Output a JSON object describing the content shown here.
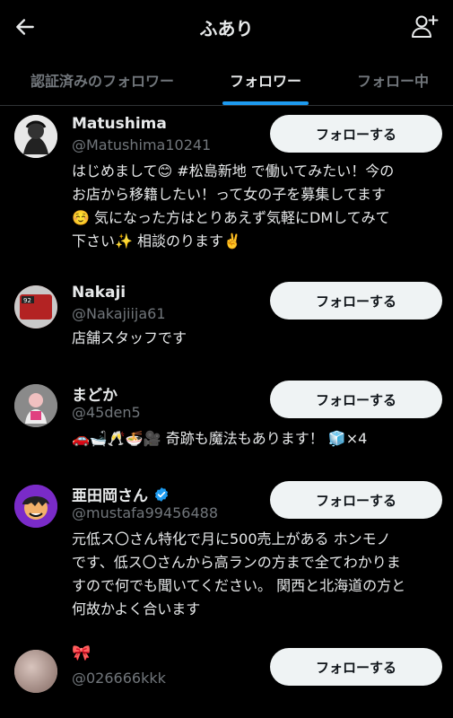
{
  "header": {
    "title": "ふあり",
    "back_icon": "arrow-left-icon",
    "add_icon": "add-user-icon"
  },
  "tabs": [
    {
      "label": "認証済みのフォロワー",
      "active": false
    },
    {
      "label": "フォロワー",
      "active": true
    },
    {
      "label": "フォロー中",
      "active": false
    }
  ],
  "colors": {
    "accent": "#1d9bf0",
    "background": "#000000",
    "secondary_text": "#71767b",
    "button_bg": "#eff3f4"
  },
  "users": [
    {
      "name": "Matushima",
      "handle": "@Matushima10241",
      "bio_lines": [
        "はじめまして😊 #松島新地 で働いてみたい！今の",
        "お店から移籍したい！って女の子を募集してます",
        "☺️ 気になった方はとりあえず気軽にDMしてみて",
        "下さい✨ 相談のります✌️"
      ],
      "follow_label": "フォローする",
      "verified": false
    },
    {
      "name": "Nakaji",
      "handle": "@Nakajiija61",
      "bio_lines": [
        "店舗スタッフです"
      ],
      "follow_label": "フォローする",
      "verified": false
    },
    {
      "name": "まどか",
      "handle": "@45den5",
      "bio_lines": [
        "🚗🛁🥂🍜🎥 奇跡も魔法もあります！ 🧊×4"
      ],
      "follow_label": "フォローする",
      "verified": false
    },
    {
      "name": "亜田岡さん",
      "handle": "@mustafa99456488",
      "bio_lines": [
        "元低ス〇さん特化で月に500売上がある ホンモノ",
        "です、低ス〇さんから高ランの方まで全てわかりま",
        "すので何でも聞いてください。 関西と北海道の方と",
        "何故かよく合います"
      ],
      "follow_label": "フォローする",
      "verified": true
    },
    {
      "name": "🎀",
      "handle": "@026666kkk",
      "bio_lines": [],
      "follow_label": "フォローする",
      "verified": false
    }
  ]
}
